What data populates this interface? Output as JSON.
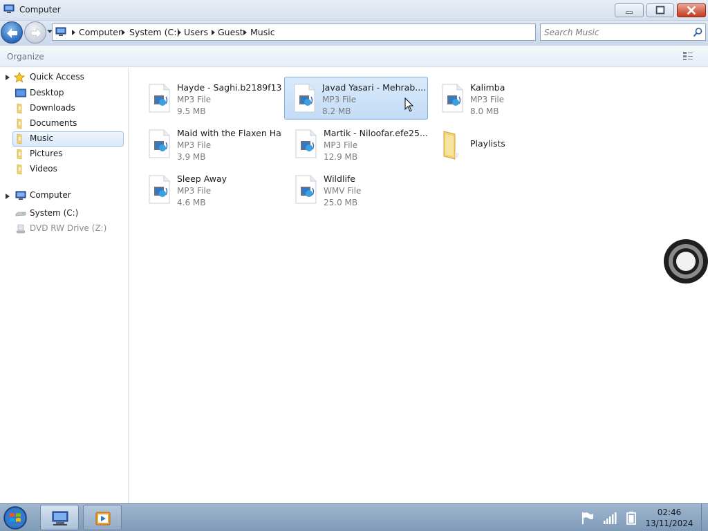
{
  "window": {
    "title": "Computer",
    "controls": {
      "minimize": "minimize",
      "maximize": "maximize",
      "close": "close"
    }
  },
  "navigation": {
    "breadcrumb": [
      "Computer",
      "System (C:)",
      "Users",
      "Guest",
      "Music"
    ],
    "search_placeholder": "Search Music"
  },
  "toolbar": {
    "organize_label": "Organize"
  },
  "sidebar": {
    "groups": [
      {
        "label": "Quick Access",
        "icon": "star-icon",
        "items": [
          {
            "label": "Desktop",
            "icon": "desktop-icon"
          },
          {
            "label": "Downloads",
            "icon": "folder-icon"
          },
          {
            "label": "Documents",
            "icon": "folder-icon"
          },
          {
            "label": "Music",
            "icon": "folder-icon",
            "selected": true
          },
          {
            "label": "Pictures",
            "icon": "folder-icon"
          },
          {
            "label": "Videos",
            "icon": "folder-icon"
          }
        ]
      },
      {
        "label": "Computer",
        "icon": "computer-icon",
        "items": [
          {
            "label": "System (C:)",
            "icon": "drive-icon"
          },
          {
            "label": "DVD RW Drive (Z:)",
            "icon": "dvd-drive-icon",
            "disabled": true
          }
        ]
      }
    ]
  },
  "files": [
    {
      "name": "Hayde - Saghi.b2189f13",
      "type": "MP3 File",
      "size": "9.5 MB",
      "icon": "media-file-icon"
    },
    {
      "name": "Javad Yasari - Mehrab....",
      "type": "MP3 File",
      "size": "8.2 MB",
      "icon": "media-file-icon",
      "selected": true
    },
    {
      "name": "Kalimba",
      "type": "MP3 File",
      "size": "8.0 MB",
      "icon": "media-file-icon"
    },
    {
      "name": "Maid with the Flaxen Hair",
      "type": "MP3 File",
      "size": "3.9 MB",
      "icon": "media-file-icon"
    },
    {
      "name": "Martik - Niloofar.efe25...",
      "type": "MP3 File",
      "size": "12.9 MB",
      "icon": "media-file-icon"
    },
    {
      "name": "Playlists",
      "type": "",
      "size": "",
      "icon": "folder-icon"
    },
    {
      "name": "Sleep Away",
      "type": "MP3 File",
      "size": "4.6 MB",
      "icon": "media-file-icon"
    },
    {
      "name": "Wildlife",
      "type": "WMV File",
      "size": "25.0 MB",
      "icon": "media-file-icon"
    }
  ],
  "taskbar": {
    "buttons": [
      {
        "name": "start-button",
        "icon": "windows-logo-icon"
      },
      {
        "name": "explorer-taskbar-button",
        "icon": "computer-icon"
      },
      {
        "name": "media-player-taskbar-button",
        "icon": "media-player-icon"
      }
    ],
    "tray": [
      "flag-icon",
      "signal-icon",
      "battery-icon"
    ],
    "clock": {
      "time": "02:46",
      "date": "13/11/2024"
    }
  },
  "colors": {
    "selection": "#c4dcf7",
    "selection_border": "#7fb1e6",
    "taskbar": "#8ea8c4",
    "close_button": "#c43c1d",
    "folder": "#f3d36b"
  }
}
